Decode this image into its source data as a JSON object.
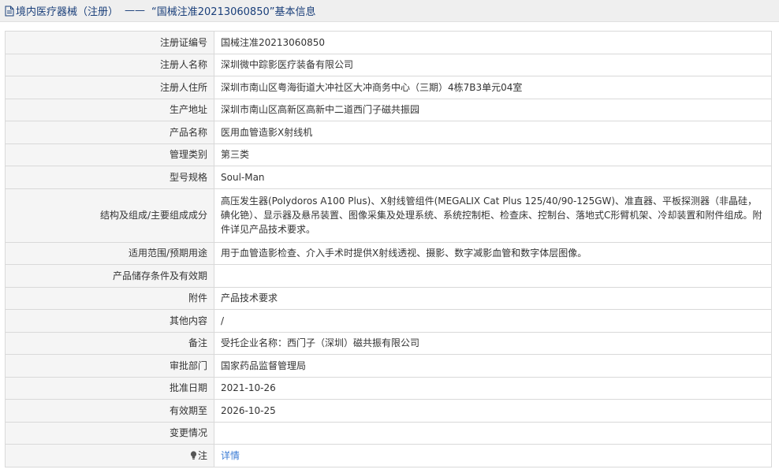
{
  "header": {
    "title_prefix": "境内医疗器械（注册）",
    "separator": "——",
    "title_main": "“国械注准20213060850”基本信息"
  },
  "rows": [
    {
      "label": "注册证编号",
      "value": "国械注准20213060850"
    },
    {
      "label": "注册人名称",
      "value": "深圳微中踪影医疗装备有限公司"
    },
    {
      "label": "注册人住所",
      "value": "深圳市南山区粤海街道大冲社区大冲商务中心（三期）4栋7B3单元04室"
    },
    {
      "label": "生产地址",
      "value": "深圳市南山区高新区高新中二道西门子磁共振园"
    },
    {
      "label": "产品名称",
      "value": "医用血管造影X射线机"
    },
    {
      "label": "管理类别",
      "value": "第三类"
    },
    {
      "label": "型号规格",
      "value": "Soul-Man"
    },
    {
      "label": "结构及组成/主要组成成分",
      "value": "高压发生器(Polydoros A100 Plus)、X射线管组件(MEGALIX Cat Plus 125/40/90-125GW)、准直器、平板探测器（非晶硅，碘化铯）、显示器及悬吊装置、图像采集及处理系统、系统控制柜、检查床、控制台、落地式C形臂机架、冷却装置和附件组成。附件详见产品技术要求。"
    },
    {
      "label": "适用范围/预期用途",
      "value": "用于血管造影检查、介入手术时提供X射线透视、摄影、数字减影血管和数字体层图像。"
    },
    {
      "label": "产品储存条件及有效期",
      "value": ""
    },
    {
      "label": "附件",
      "value": "产品技术要求"
    },
    {
      "label": "其他内容",
      "value": "/"
    },
    {
      "label": "备注",
      "value": "受托企业名称：西门子（深圳）磁共振有限公司"
    },
    {
      "label": "审批部门",
      "value": "国家药品监督管理局"
    },
    {
      "label": "批准日期",
      "value": "2021-10-26"
    },
    {
      "label": "有效期至",
      "value": "2026-10-25"
    },
    {
      "label": "变更情况",
      "value": ""
    }
  ],
  "note": {
    "label": "注",
    "link_text": "详情"
  }
}
